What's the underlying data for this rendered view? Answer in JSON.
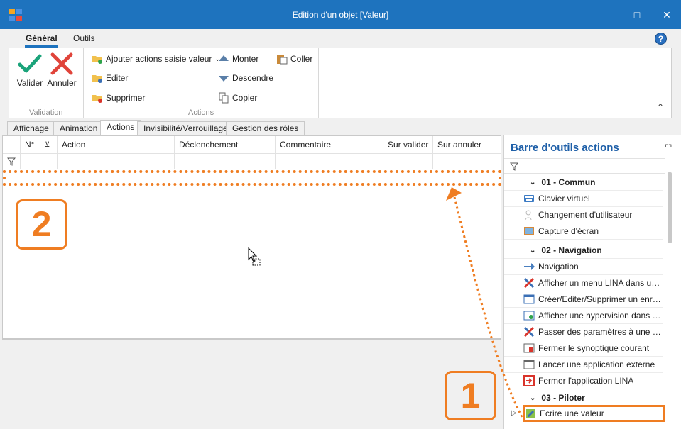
{
  "window": {
    "title": "Edition d'un objet [Valeur]"
  },
  "ribbon": {
    "tabs": [
      {
        "label": "Général",
        "active": true
      },
      {
        "label": "Outils",
        "active": false
      }
    ],
    "validation": {
      "group_label": "Validation",
      "validate_label": "Valider",
      "cancel_label": "Annuler"
    },
    "actions": {
      "group_label": "Actions",
      "add_label": "Ajouter actions saisie valeur",
      "edit_label": "Editer",
      "delete_label": "Supprimer",
      "up_label": "Monter",
      "down_label": "Descendre",
      "copy_label": "Copier",
      "paste_label": "Coller"
    }
  },
  "doc_tabs": [
    {
      "label": "Affichage",
      "active": false
    },
    {
      "label": "Animation",
      "active": false
    },
    {
      "label": "Actions",
      "active": true
    },
    {
      "label": "Invisibilité/Verrouillage",
      "active": false
    },
    {
      "label": "Gestion des rôles",
      "active": false
    }
  ],
  "grid": {
    "columns": [
      "N°",
      "Action",
      "Déclenchement",
      "Commentaire",
      "Sur valider",
      "Sur annuler"
    ]
  },
  "annotations": {
    "badge_1": "1",
    "badge_2": "2"
  },
  "toolbar_panel": {
    "title": "Barre d'outils actions",
    "groups": [
      {
        "label": "01 - Commun",
        "items": [
          "Clavier virtuel",
          "Changement d'utilisateur",
          "Capture d'écran"
        ]
      },
      {
        "label": "02 - Navigation",
        "items": [
          "Navigation",
          "Afficher un menu LINA dans une ...",
          "Créer/Editer/Supprimer un enregi...",
          "Afficher une hypervision dans un ...",
          "Passer des paramètres à une hyp...",
          "Fermer le synoptique courant",
          "Lancer une application externe",
          "Fermer l'application LINA"
        ]
      },
      {
        "label": "03 - Piloter",
        "items": [
          "Ecrire une valeur"
        ]
      }
    ]
  },
  "colors": {
    "titlebar": "#1e73be",
    "accent_orange": "#ef7d22",
    "panel_title": "#1e5fa8"
  }
}
